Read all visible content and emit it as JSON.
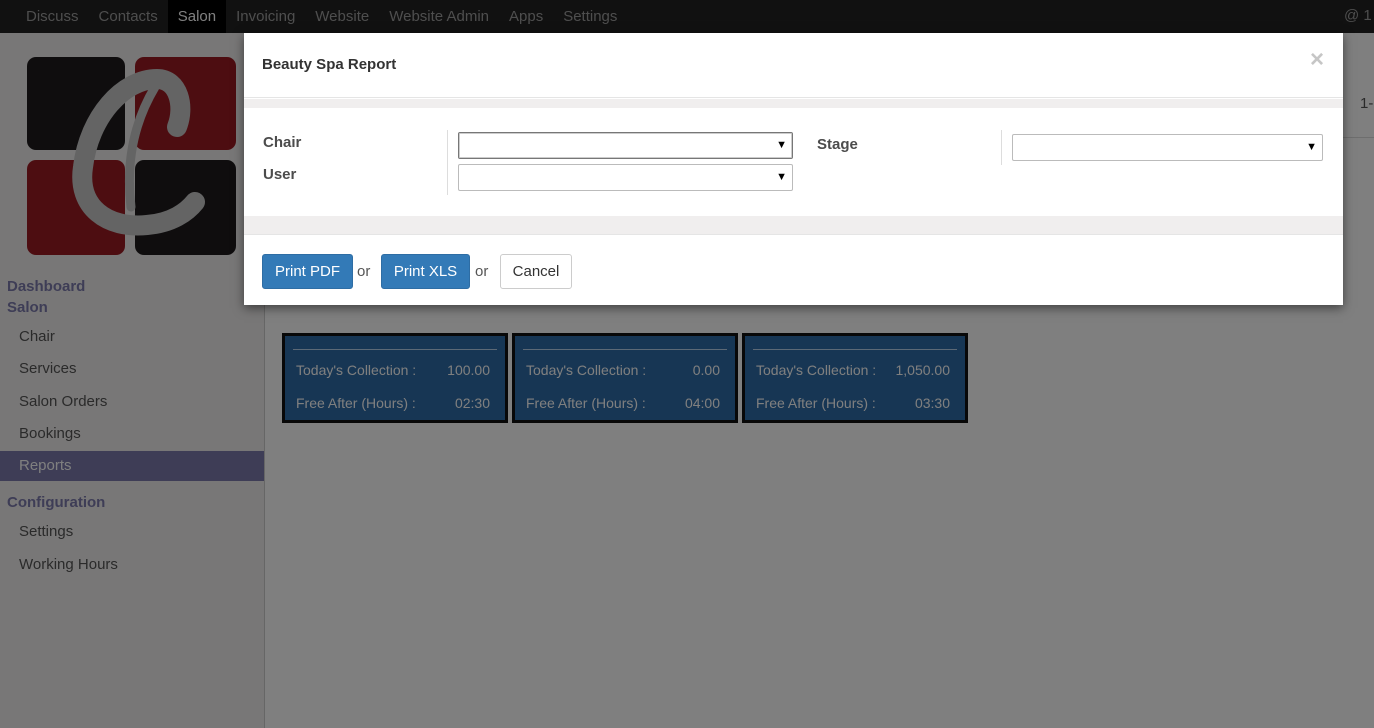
{
  "topbar": {
    "menu": [
      "Discuss",
      "Contacts",
      "Salon",
      "Invoicing",
      "Website",
      "Website Admin",
      "Apps",
      "Settings"
    ],
    "active": "Salon",
    "right_text": "@ 1"
  },
  "sidebar": {
    "sections": {
      "dashboard": "Dashboard",
      "salon": "Salon",
      "configuration": "Configuration"
    },
    "salon_items": [
      "Chair",
      "Services",
      "Salon Orders",
      "Bookings",
      "Reports"
    ],
    "config_items": [
      "Settings",
      "Working Hours"
    ],
    "active_item": "Reports"
  },
  "main": {
    "pager_text": "1-"
  },
  "cards": [
    {
      "collection_label": "Today's Collection :",
      "collection_value": "100.00",
      "free_label": "Free After (Hours) :",
      "free_value": "02:30"
    },
    {
      "collection_label": "Today's Collection :",
      "collection_value": "0.00",
      "free_label": "Free After (Hours) :",
      "free_value": "04:00"
    },
    {
      "collection_label": "Today's Collection :",
      "collection_value": "1,050.00",
      "free_label": "Free After (Hours) :",
      "free_value": "03:30"
    }
  ],
  "modal": {
    "title": "Beauty Spa Report",
    "close": "×",
    "fields": {
      "chair": {
        "label": "Chair",
        "value": ""
      },
      "user": {
        "label": "User",
        "value": ""
      },
      "stage": {
        "label": "Stage",
        "value": ""
      }
    },
    "dropdown_arrow": "▼",
    "buttons": {
      "print_pdf": "Print PDF",
      "print_xls": "Print XLS",
      "cancel": "Cancel",
      "or": "or"
    }
  },
  "colors": {
    "accent": "#7c7bad",
    "primary_button": "#337ab7",
    "card_bg": "#2f6da8",
    "topbar": "#222222",
    "logo_red": "#9b1b22",
    "logo_dark": "#1e1b1d"
  }
}
